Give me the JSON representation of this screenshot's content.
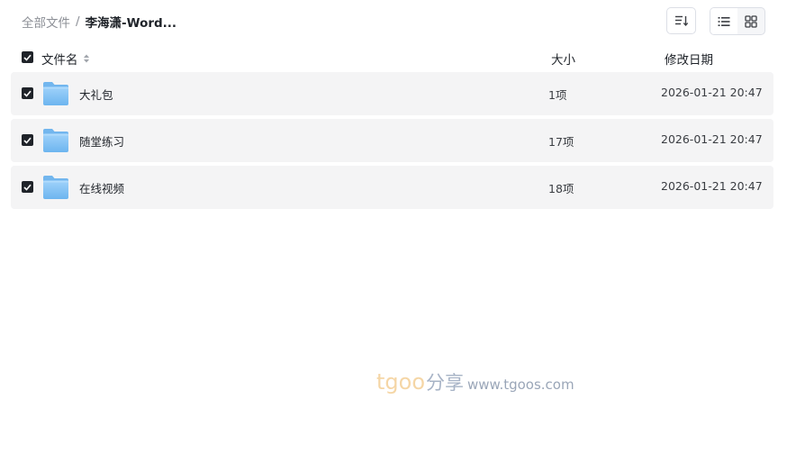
{
  "breadcrumb": {
    "root": "全部文件",
    "separator": "/",
    "current": "李海潇-Word..."
  },
  "toolbar": {
    "sort_icon": "sort-lines-icon",
    "list_view_icon": "list-view-icon",
    "grid_view_icon": "grid-view-icon",
    "active_view": "list"
  },
  "table": {
    "headers": {
      "name": "文件名",
      "size": "大小",
      "date": "修改日期"
    },
    "rows": [
      {
        "name": "大礼包",
        "size": "1项",
        "date": "2026-01-21 20:47",
        "checked": true,
        "icon": "folder-icon"
      },
      {
        "name": "随堂练习",
        "size": "17项",
        "date": "2026-01-21 20:47",
        "checked": true,
        "icon": "folder-icon"
      },
      {
        "name": "在线视频",
        "size": "18项",
        "date": "2026-01-21 20:47",
        "checked": true,
        "icon": "folder-icon"
      }
    ]
  },
  "watermark": {
    "brand": "tgoo",
    "brand_suffix": "分享",
    "url": "www.tgoos.com"
  },
  "colors": {
    "row_background": "#f4f4f5",
    "checkbox": "#1f2329",
    "folder": "#7ec0f4"
  }
}
